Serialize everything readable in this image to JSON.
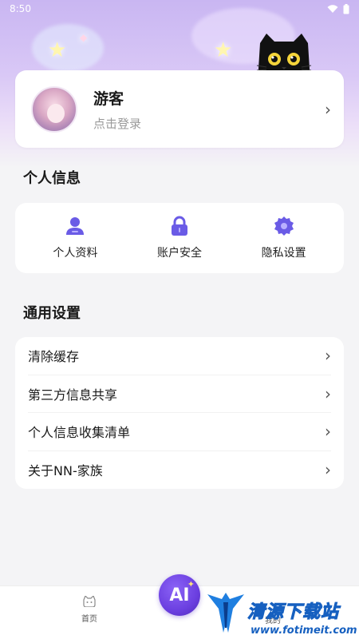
{
  "status_bar": {
    "time": "8:50"
  },
  "profile": {
    "name": "游客",
    "subtitle": "点击登录"
  },
  "personal_info": {
    "title": "个人信息",
    "items": [
      {
        "label": "个人资料",
        "icon": "user-icon"
      },
      {
        "label": "账户安全",
        "icon": "lock-icon"
      },
      {
        "label": "隐私设置",
        "icon": "gear-icon"
      }
    ]
  },
  "general_settings": {
    "title": "通用设置",
    "items": [
      {
        "label": "清除缓存"
      },
      {
        "label": "第三方信息共享"
      },
      {
        "label": "个人信息收集清单"
      },
      {
        "label": "关于NN-家族"
      }
    ]
  },
  "bottom_nav": {
    "home_label": "首页",
    "ai_label": "AI",
    "mine_label": "我的"
  },
  "watermark": {
    "name": "清源下载站",
    "url": "www.fotimeit.com"
  },
  "colors": {
    "accent": "#6b4fe0",
    "icon_purple": "#6a5be6",
    "background": "#f4f4f6"
  }
}
